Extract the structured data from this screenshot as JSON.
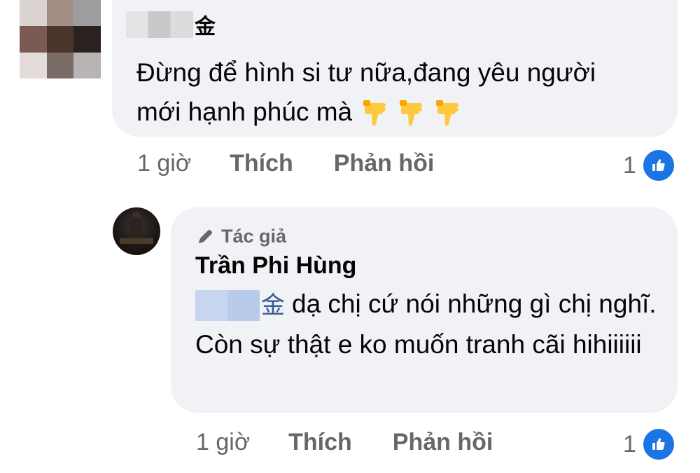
{
  "comments": [
    {
      "author_suffix": "金",
      "text": "Đừng để hình si tư nữa,đang yêu người mới hạnh phúc mà",
      "reaction_emoji_icon": "thumbs-down-icon",
      "time": "1 giờ",
      "like_label": "Thích",
      "reply_label": "Phản hồi",
      "reaction_count": "1"
    }
  ],
  "reply": {
    "badge": "Tác giả",
    "author": "Trần Phi Hùng",
    "mention_suffix": "金",
    "text": "dạ chị cứ nói những gì chị nghĩ. Còn sự thật e ko muốn tranh cãi hihiiiiii",
    "time": "1 giờ",
    "like_label": "Thích",
    "reply_label": "Phản hồi",
    "reaction_count": "1"
  },
  "colors": {
    "bubble": "#f0f2f5",
    "meta": "#65676b",
    "like_blue": "#1b74e4",
    "thumb_yellow": "#ffc83d"
  }
}
